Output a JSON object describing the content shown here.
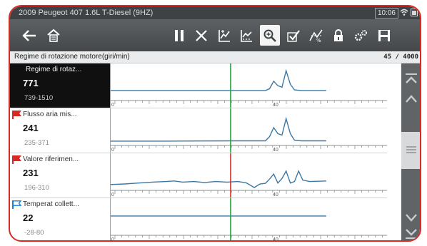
{
  "status": {
    "title": "2009 Peugeot 407 1.6L T-Diesel (9HZ)",
    "time": "10:06"
  },
  "toolbar": {
    "icons": [
      "back-icon",
      "home-icon",
      "pause-icon",
      "clear-icon",
      "graph-scale-icon",
      "graph-fit-icon",
      "zoom-icon",
      "check-icon",
      "pid-select-icon",
      "lock-icon",
      "settings-icon",
      "save-icon"
    ]
  },
  "header": {
    "label": "Regime di rotazione motore(giri/min)",
    "count": "45 / 4000"
  },
  "params": [
    {
      "name": "Regime di rotaz...",
      "value": "771",
      "range": "739-1510",
      "flag": "none",
      "tick": "40",
      "left_label": "0",
      "trace": [
        [
          0,
          0.24
        ],
        [
          0.2,
          0.24
        ],
        [
          0.45,
          0.24
        ],
        [
          0.56,
          0.24
        ],
        [
          0.575,
          0.3
        ],
        [
          0.59,
          0.55
        ],
        [
          0.605,
          0.4
        ],
        [
          0.62,
          0.35
        ],
        [
          0.635,
          0.9
        ],
        [
          0.65,
          0.45
        ],
        [
          0.665,
          0.26
        ],
        [
          0.69,
          0.24
        ],
        [
          0.78,
          0.24
        ]
      ],
      "cursor_color": "#17a33a"
    },
    {
      "name": "Flusso aria mis...",
      "value": "241",
      "range": "235-371",
      "flag": "red",
      "tick": "40",
      "left_label": "0",
      "trace": [
        [
          0,
          0.05
        ],
        [
          0.2,
          0.05
        ],
        [
          0.45,
          0.06
        ],
        [
          0.56,
          0.06
        ],
        [
          0.575,
          0.2
        ],
        [
          0.59,
          0.5
        ],
        [
          0.605,
          0.3
        ],
        [
          0.62,
          0.25
        ],
        [
          0.635,
          0.8
        ],
        [
          0.65,
          0.3
        ],
        [
          0.665,
          0.08
        ],
        [
          0.69,
          0.06
        ],
        [
          0.78,
          0.06
        ]
      ],
      "cursor_color": "#17a33a"
    },
    {
      "name": "Valore riferimen...",
      "value": "231",
      "range": "196-310",
      "flag": "red",
      "tick": "40",
      "left_label": "0",
      "trace": [
        [
          0,
          0.1
        ],
        [
          0.05,
          0.12
        ],
        [
          0.1,
          0.15
        ],
        [
          0.15,
          0.18
        ],
        [
          0.2,
          0.2
        ],
        [
          0.23,
          0.22
        ],
        [
          0.26,
          0.18
        ],
        [
          0.3,
          0.2
        ],
        [
          0.34,
          0.17
        ],
        [
          0.38,
          0.2
        ],
        [
          0.42,
          0.18
        ],
        [
          0.46,
          0.2
        ],
        [
          0.49,
          0.16
        ],
        [
          0.52,
          0.0
        ],
        [
          0.54,
          0.12
        ],
        [
          0.56,
          0.14
        ],
        [
          0.575,
          0.28
        ],
        [
          0.59,
          0.45
        ],
        [
          0.605,
          0.15
        ],
        [
          0.62,
          0.3
        ],
        [
          0.635,
          0.55
        ],
        [
          0.65,
          0.15
        ],
        [
          0.665,
          0.2
        ],
        [
          0.68,
          0.55
        ],
        [
          0.695,
          0.25
        ],
        [
          0.72,
          0.2
        ],
        [
          0.78,
          0.22
        ]
      ],
      "cursor_color": "#d62a22"
    },
    {
      "name": "Temperat collett...",
      "value": "22",
      "range": "-28-80",
      "flag": "blue",
      "tick": "40",
      "left_label": "0",
      "trace": [
        [
          0,
          0.55
        ],
        [
          0.78,
          0.55
        ]
      ],
      "cursor_color": "#17a33a"
    }
  ],
  "scrollbar": {
    "position": 0.45
  }
}
